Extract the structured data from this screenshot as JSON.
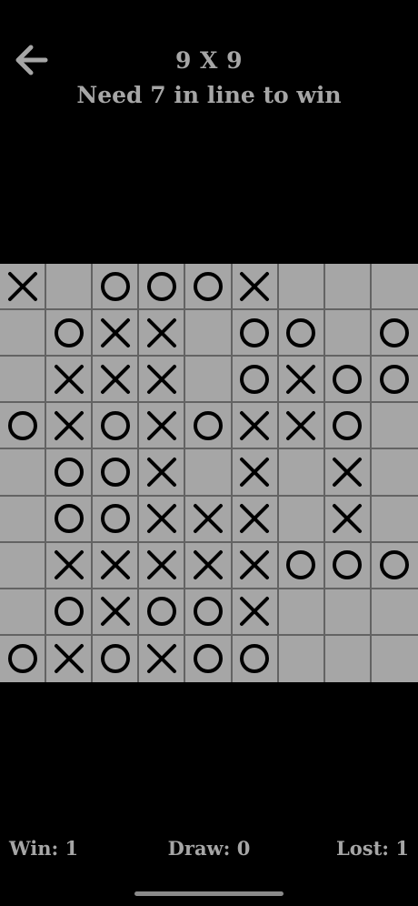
{
  "header": {
    "back_icon": "arrow-left-icon",
    "title": "9 X 9",
    "subtitle": "Need 7 in line to win"
  },
  "board": {
    "size": 9,
    "rows": [
      [
        "X",
        "",
        "O",
        "O",
        "O",
        "X",
        "",
        "",
        ""
      ],
      [
        "",
        "O",
        "X",
        "X",
        "",
        "O",
        "O",
        "",
        "O"
      ],
      [
        "",
        "X",
        "X",
        "X",
        "",
        "O",
        "X",
        "O",
        "O"
      ],
      [
        "O",
        "X",
        "O",
        "X",
        "O",
        "X",
        "X",
        "O",
        ""
      ],
      [
        "",
        "O",
        "O",
        "X",
        "",
        "X",
        "",
        "X",
        ""
      ],
      [
        "",
        "O",
        "O",
        "X",
        "X",
        "X",
        "",
        "X",
        ""
      ],
      [
        "",
        "X",
        "X",
        "X",
        "X",
        "X",
        "O",
        "O",
        "O"
      ],
      [
        "",
        "O",
        "X",
        "O",
        "O",
        "X",
        "",
        "",
        ""
      ],
      [
        "O",
        "X",
        "O",
        "X",
        "O",
        "O",
        "",
        "",
        ""
      ]
    ],
    "cell_color": "#a6a6a6",
    "line_color": "#636363",
    "mark_color": "#000000"
  },
  "footer": {
    "win": "Win: 1",
    "draw": "Draw: 0",
    "lost": "Lost: 1"
  },
  "colors": {
    "background": "#000000",
    "text": "#a6a6a6"
  }
}
